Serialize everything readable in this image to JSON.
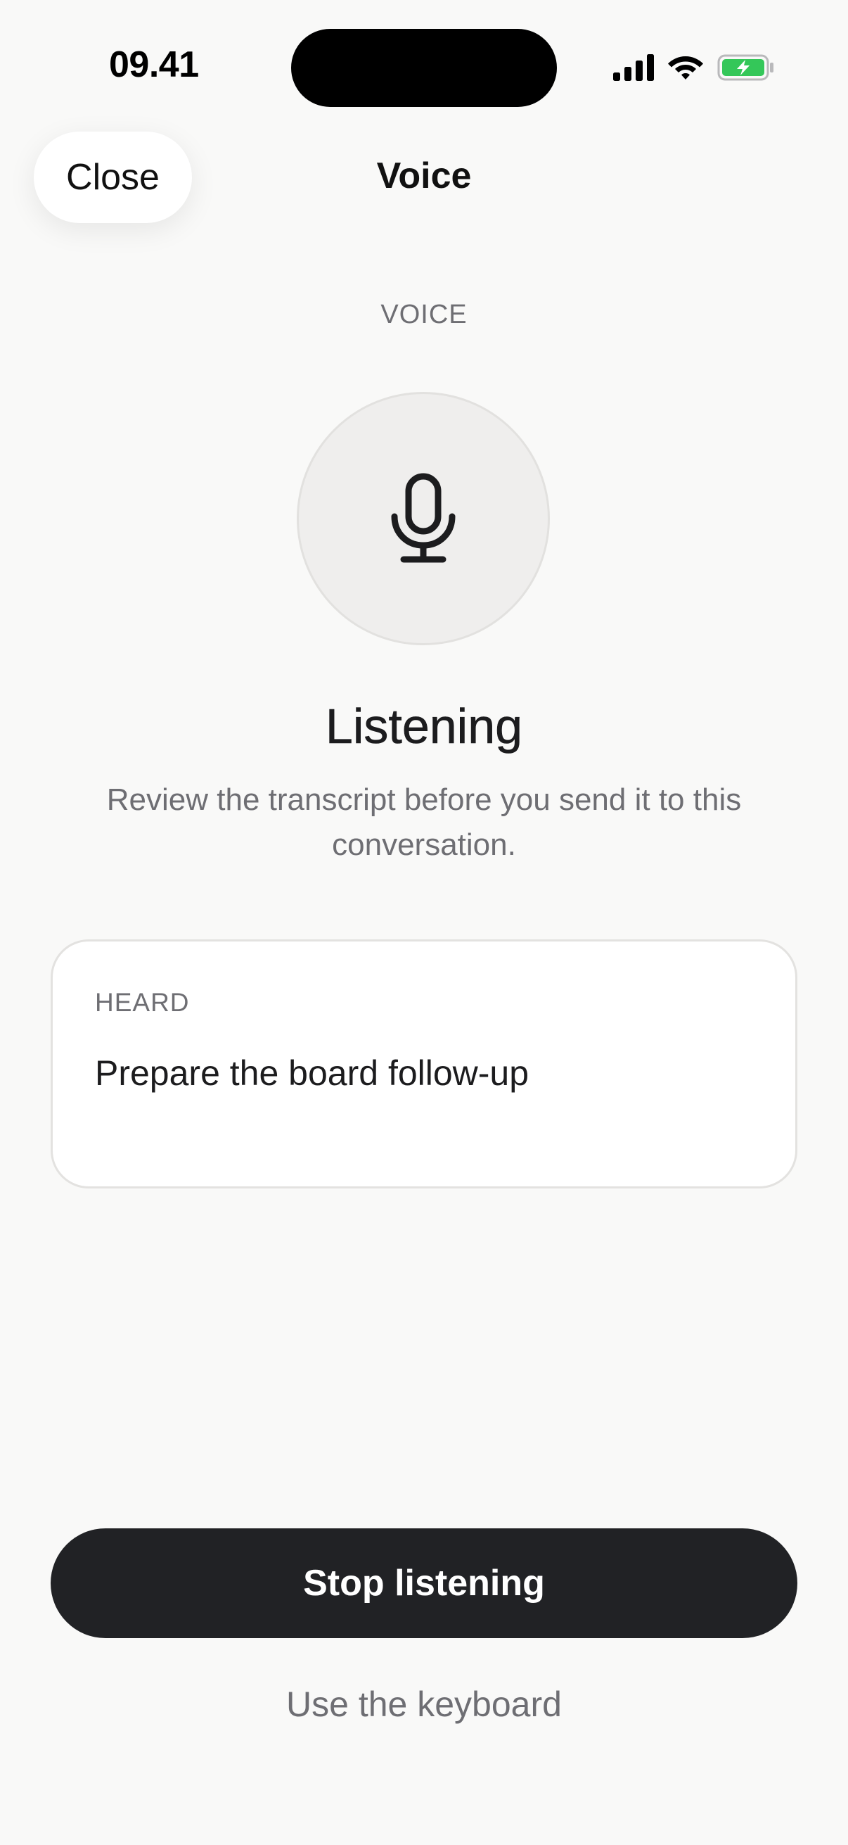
{
  "status_bar": {
    "time": "09.41",
    "icons": [
      "cellular-signal-icon",
      "wifi-icon",
      "battery-charging-icon"
    ],
    "battery_color": "#34c759"
  },
  "nav": {
    "close_label": "Close",
    "title": "Voice"
  },
  "main": {
    "section_label": "VOICE",
    "mic_icon": "microphone-icon",
    "status_title": "Listening",
    "status_description": "Review the transcript before you send it to this conversation."
  },
  "transcript": {
    "label": "HEARD",
    "text": "Prepare the board follow-up"
  },
  "actions": {
    "primary_label": "Stop listening",
    "secondary_label": "Use the keyboard"
  },
  "colors": {
    "background": "#f9f9f8",
    "primary_button": "#212225",
    "muted_text": "#6e6e73"
  }
}
